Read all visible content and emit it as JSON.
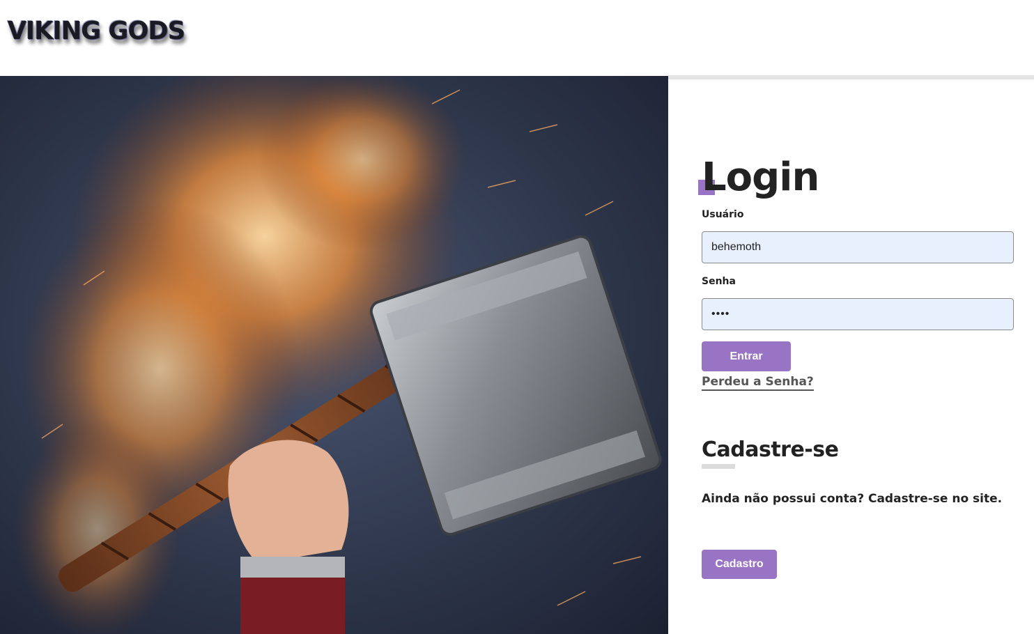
{
  "header": {
    "logo_text": "VIKING GODS"
  },
  "hero": {
    "image_icon": "thor-hammer-fire-image"
  },
  "login": {
    "title": "Login",
    "username_label": "Usuário",
    "username_value": "behemoth",
    "password_label": "Senha",
    "password_value": "••••",
    "submit_label": "Entrar",
    "forgot_link": "Perdeu a Senha?"
  },
  "register": {
    "title": "Cadastre-se",
    "description": "Ainda não possui conta? Cadastre-se no site.",
    "button_label": "Cadastro"
  },
  "colors": {
    "accent": "#9a74c4",
    "input_bg": "#e8f0fe",
    "text": "#222222"
  }
}
